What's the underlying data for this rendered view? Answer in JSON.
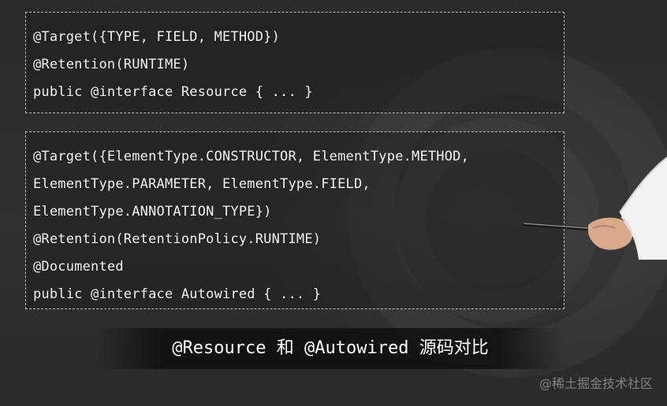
{
  "code_blocks": [
    {
      "lines": [
        "@Target({TYPE, FIELD, METHOD})",
        "@Retention(RUNTIME)",
        "public @interface Resource { ... }"
      ]
    },
    {
      "lines": [
        "@Target({ElementType.CONSTRUCTOR, ElementType.METHOD,",
        "ElementType.PARAMETER, ElementType.FIELD,",
        "ElementType.ANNOTATION_TYPE})",
        "@Retention(RetentionPolicy.RUNTIME)",
        "@Documented",
        "public @interface Autowired { ... }"
      ]
    }
  ],
  "caption": "@Resource 和 @Autowired 源码对比",
  "watermark": "@稀土掘金技术社区",
  "colors": {
    "background": "#2f2f2f",
    "code_text": "#f0f0f0",
    "box_border": "#bdbdbd"
  }
}
